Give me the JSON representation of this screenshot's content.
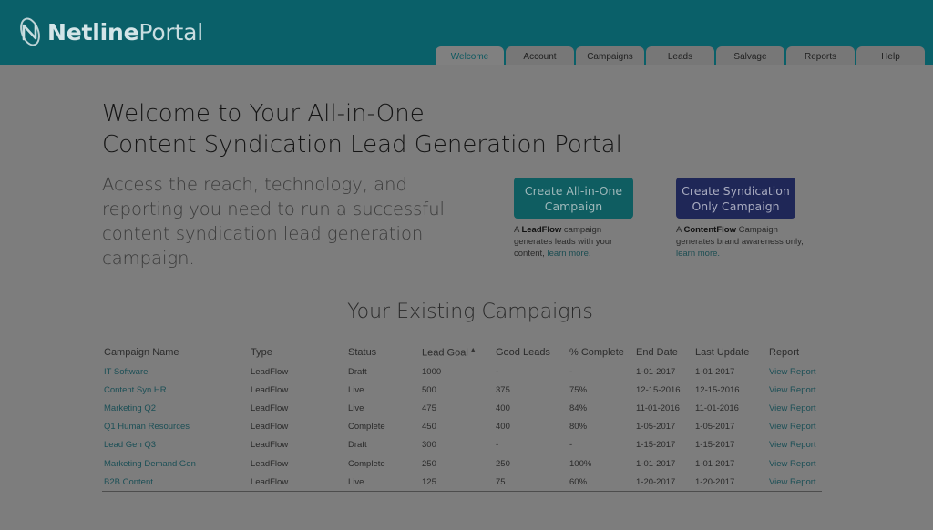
{
  "app": {
    "logo_bold": "Netline",
    "logo_light": "Portal",
    "logo_icon": "netline-swirl-icon"
  },
  "nav": {
    "tabs": [
      {
        "label": "Welcome",
        "active": true
      },
      {
        "label": "Account"
      },
      {
        "label": "Campaigns"
      },
      {
        "label": "Leads"
      },
      {
        "label": "Salvage"
      },
      {
        "label": "Reports"
      },
      {
        "label": "Help"
      }
    ]
  },
  "hero": {
    "headline_line1": "Welcome to Your All-in-One",
    "headline_line2": "Content Syndication Lead Generation Portal",
    "intro": "Access the reach, technology, and reporting you need to run a successful content syndication lead generation campaign."
  },
  "cta": {
    "all_in_one": {
      "line1": "Create All-in-One",
      "line2": "Campaign",
      "desc_prefix": "A ",
      "desc_brand": "LeadFlow",
      "desc_mid": " campaign generates leads with your content, ",
      "desc_link": "learn more."
    },
    "syndication": {
      "line1": "Create Syndication",
      "line2": "Only Campaign",
      "desc_prefix": "A ",
      "desc_brand": "ContentFlow",
      "desc_mid": " Campaign generates brand awareness only, ",
      "desc_link": "learn more."
    }
  },
  "campaigns": {
    "title": "Your Existing Campaigns",
    "columns": [
      "Campaign Name",
      "Type",
      "Status",
      "Lead Goal",
      "Good Leads",
      "% Complete",
      "End Date",
      "Last Update",
      "Report"
    ],
    "sort_icon": "sort-arrows-icon",
    "rows": [
      [
        "IT Software",
        "LeadFlow",
        "Draft",
        "1000",
        "-",
        "-",
        "1-01-2017",
        "1-01-2017",
        "View Report"
      ],
      [
        "Content Syn HR",
        "LeadFlow",
        "Live",
        "500",
        "375",
        "75%",
        "12-15-2016",
        "12-15-2016",
        "View Report"
      ],
      [
        "Marketing Q2",
        "LeadFlow",
        "Live",
        "475",
        "400",
        "84%",
        "11-01-2016",
        "11-01-2016",
        "View Report"
      ],
      [
        "Q1 Human Resources",
        "LeadFlow",
        "Complete",
        "450",
        "400",
        "80%",
        "1-05-2017",
        "1-05-2017",
        "View Report"
      ],
      [
        "Lead Gen Q3",
        "LeadFlow",
        "Draft",
        "300",
        "-",
        "-",
        "1-15-2017",
        "1-15-2017",
        "View Report"
      ],
      [
        "Marketing Demand Gen",
        "LeadFlow",
        "Complete",
        "250",
        "250",
        "100%",
        "1-01-2017",
        "1-01-2017",
        "View Report"
      ],
      [
        "B2B Content",
        "LeadFlow",
        "Live",
        "125",
        "75",
        "60%",
        "1-20-2017",
        "1-20-2017",
        "View Report"
      ]
    ]
  },
  "colors": {
    "header": "#0a6069",
    "overlay_bg": "#7d7d7d",
    "cta_all_in_one": "#0f5d61",
    "cta_syndication": "#1f2757",
    "link": "#1b4f56"
  }
}
